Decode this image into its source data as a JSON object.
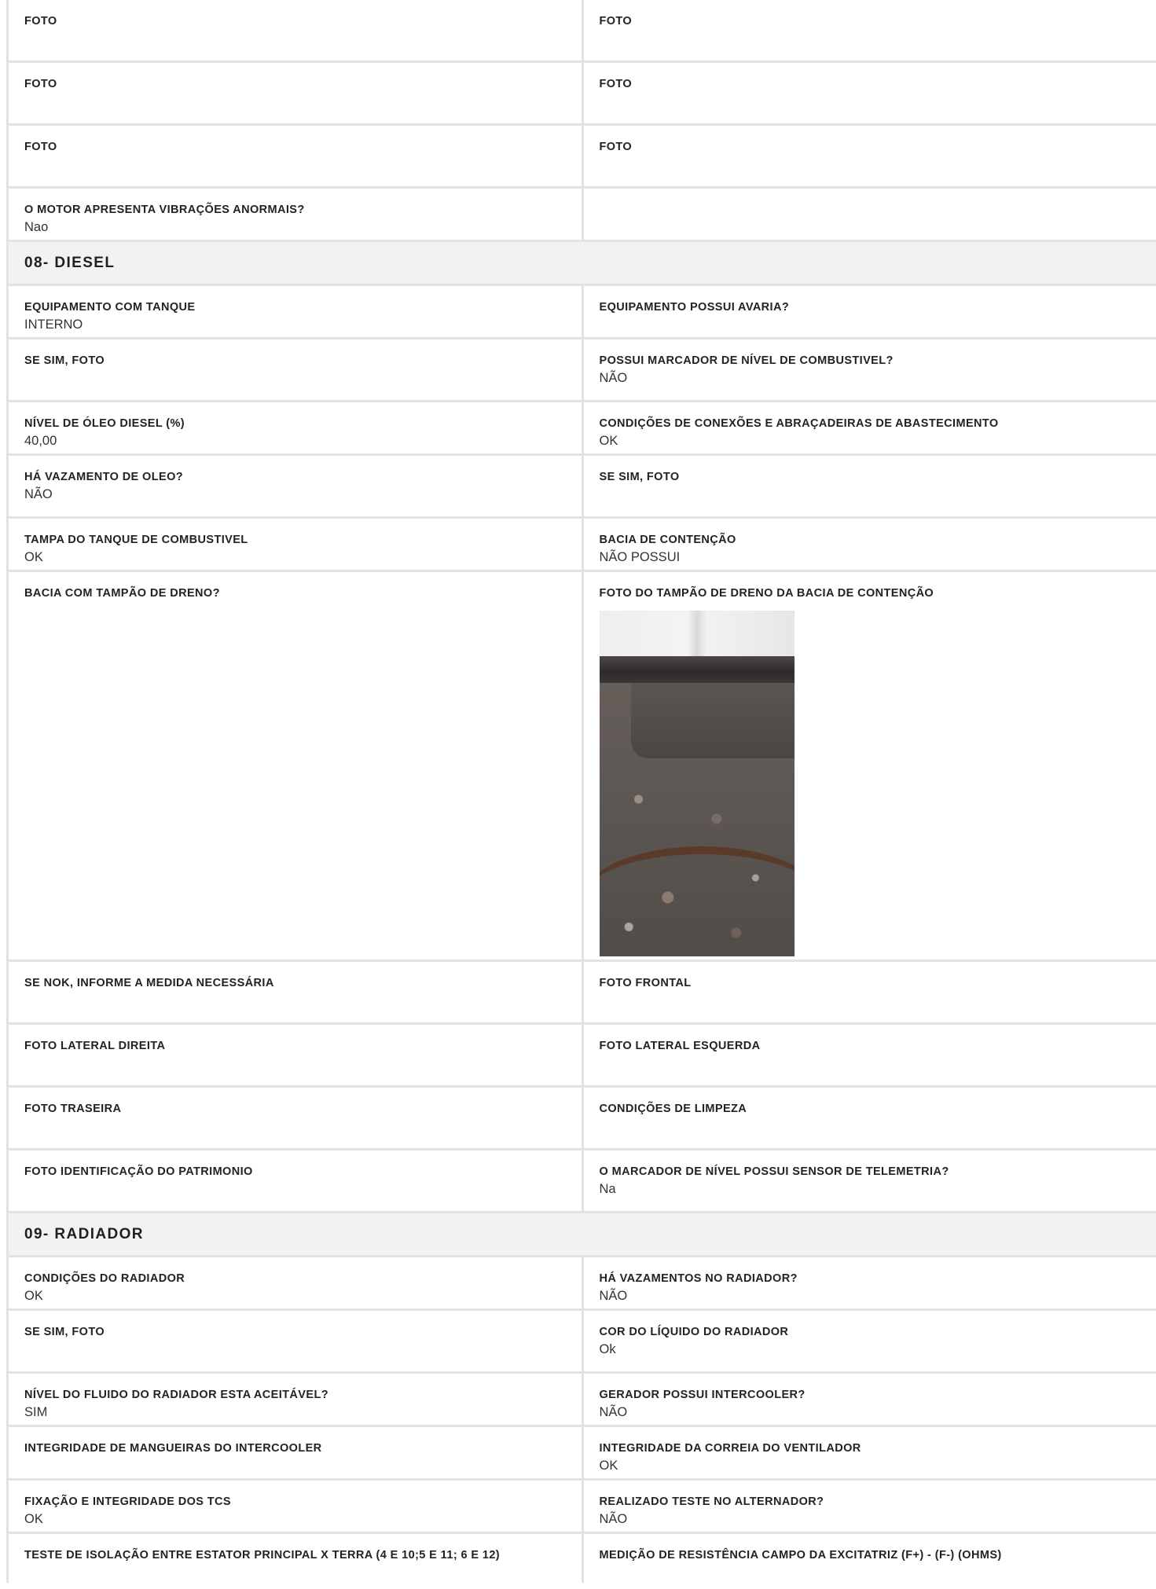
{
  "top_rows": [
    {
      "left": {
        "label": "FOTO",
        "value": ""
      },
      "right": {
        "label": "FOTO",
        "value": ""
      }
    },
    {
      "left": {
        "label": "FOTO",
        "value": ""
      },
      "right": {
        "label": "FOTO",
        "value": ""
      }
    },
    {
      "left": {
        "label": "FOTO",
        "value": ""
      },
      "right": {
        "label": "FOTO",
        "value": ""
      }
    },
    {
      "left": {
        "label": "O MOTOR APRESENTA VIBRAÇÕES ANORMAIS?",
        "value": "Nao"
      },
      "right": {
        "label": "",
        "value": ""
      }
    }
  ],
  "diesel": {
    "title": "08- DIESEL",
    "rows": [
      {
        "left": {
          "label": "EQUIPAMENTO COM TANQUE",
          "value": "INTERNO"
        },
        "right": {
          "label": "EQUIPAMENTO POSSUI AVARIA?",
          "value": ""
        }
      },
      {
        "left": {
          "label": "SE SIM, FOTO",
          "value": ""
        },
        "right": {
          "label": "POSSUI MARCADOR DE NÍVEL DE COMBUSTIVEL?",
          "value": "NÃO"
        }
      },
      {
        "left": {
          "label": "NÍVEL DE ÓLEO DIESEL (%)",
          "value": "40,00"
        },
        "right": {
          "label": "CONDIÇÕES DE CONEXÕES E ABRAÇADEIRAS DE ABASTECIMENTO",
          "value": "OK"
        }
      },
      {
        "left": {
          "label": "HÁ VAZAMENTO DE OLEO?",
          "value": "NÃO"
        },
        "right": {
          "label": "SE SIM, FOTO",
          "value": ""
        }
      },
      {
        "left": {
          "label": "TAMPA DO TANQUE DE COMBUSTIVEL",
          "value": "OK"
        },
        "right": {
          "label": "BACIA DE CONTENÇÃO",
          "value": "NÃO POSSUI"
        }
      },
      {
        "left": {
          "label": "BACIA COM TAMPÃO DE DRENO?",
          "value": ""
        },
        "right": {
          "label": "FOTO DO TAMPÃO DE DRENO DA BACIA DE CONTENÇÃO",
          "value": ""
        }
      },
      {
        "left": {
          "label": "SE NOK, INFORME A MEDIDA NECESSÁRIA",
          "value": ""
        },
        "right": {
          "label": "FOTO FRONTAL",
          "value": ""
        }
      },
      {
        "left": {
          "label": "FOTO LATERAL DIREITA",
          "value": ""
        },
        "right": {
          "label": "FOTO LATERAL ESQUERDA",
          "value": ""
        }
      },
      {
        "left": {
          "label": "FOTO TRASEIRA",
          "value": ""
        },
        "right": {
          "label": "CONDIÇÕES DE LIMPEZA",
          "value": ""
        }
      },
      {
        "left": {
          "label": "FOTO IDENTIFICAÇÃO DO PATRIMONIO",
          "value": ""
        },
        "right": {
          "label": "O MARCADOR DE NÍVEL POSSUI SENSOR DE TELEMETRIA?",
          "value": "Na"
        }
      }
    ]
  },
  "radiador": {
    "title": "09- RADIADOR",
    "rows": [
      {
        "left": {
          "label": "CONDIÇÕES DO RADIADOR",
          "value": "OK"
        },
        "right": {
          "label": "HÁ VAZAMENTOS NO RADIADOR?",
          "value": "NÃO"
        }
      },
      {
        "left": {
          "label": "SE SIM, FOTO",
          "value": ""
        },
        "right": {
          "label": "COR DO LÍQUIDO DO RADIADOR",
          "value": "Ok"
        }
      },
      {
        "left": {
          "label": "NÍVEL DO FLUIDO DO RADIADOR ESTA ACEITÁVEL?",
          "value": "SIM"
        },
        "right": {
          "label": "GERADOR POSSUI INTERCOOLER?",
          "value": "NÃO"
        }
      },
      {
        "left": {
          "label": "INTEGRIDADE DE MANGUEIRAS DO INTERCOOLER",
          "value": ""
        },
        "right": {
          "label": "INTEGRIDADE DA CORREIA DO VENTILADOR",
          "value": "OK"
        }
      },
      {
        "left": {
          "label": "FIXAÇÃO E INTEGRIDADE DOS TCS",
          "value": "OK"
        },
        "right": {
          "label": "REALIZADO TESTE NO ALTERNADOR?",
          "value": "NÃO"
        }
      },
      {
        "left": {
          "label": "TESTE DE ISOLAÇÃO ENTRE ESTATOR PRINCIPAL X TERRA (4 E 10;5 E 11; 6 E 12)",
          "value": ""
        },
        "right": {
          "label": "MEDIÇÃO DE RESISTÊNCIA CAMPO DA EXCITATRIZ (F+) - (F-) (OHMS)",
          "value": ""
        }
      }
    ]
  }
}
